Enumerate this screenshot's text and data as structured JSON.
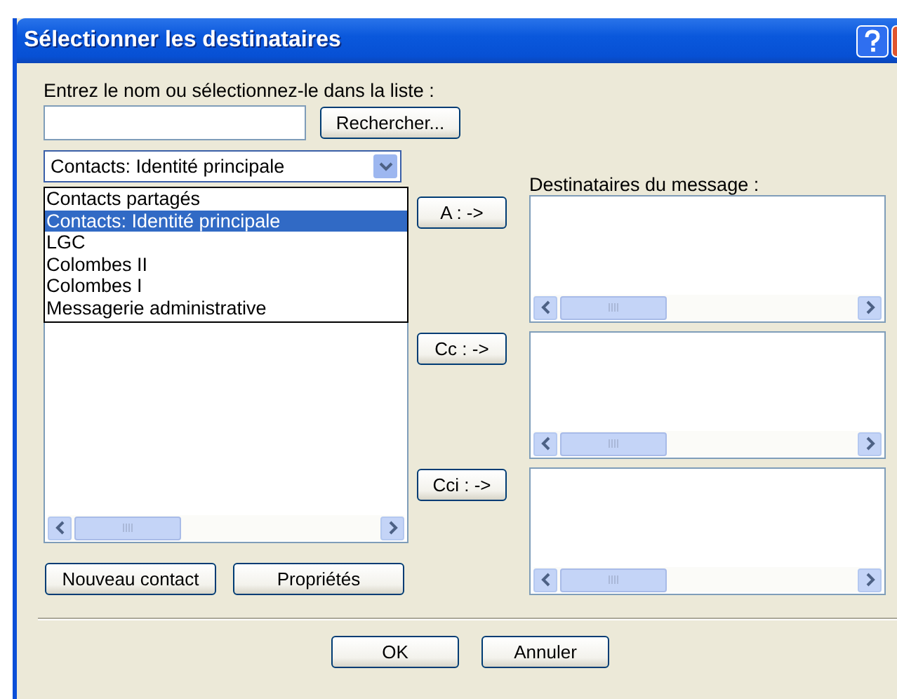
{
  "window": {
    "title": "Sélectionner les destinataires"
  },
  "search": {
    "label": "Entrez le nom ou sélectionnez-le dans la liste :",
    "button": "Rechercher..."
  },
  "address_book": {
    "value": "Contacts: Identité principale",
    "expanded": true,
    "options": [
      {
        "label": "Contacts partagés",
        "selected": false
      },
      {
        "label": "Contacts: Identité principale",
        "selected": true
      },
      {
        "label": "LGC",
        "selected": false
      },
      {
        "label": "Colombes II",
        "selected": false
      },
      {
        "label": "Colombes I",
        "selected": false
      },
      {
        "label": "Messagerie administrative",
        "selected": false
      }
    ]
  },
  "contact_buttons": [
    "Nouveau contact",
    "Propriétés"
  ],
  "recipients": {
    "label": "Destinataires du message :",
    "fields": [
      {
        "button": "A : ->"
      },
      {
        "button": "Cc : ->"
      },
      {
        "button": "Cci : ->"
      }
    ]
  },
  "buttons": [
    "OK",
    "Annuler"
  ]
}
